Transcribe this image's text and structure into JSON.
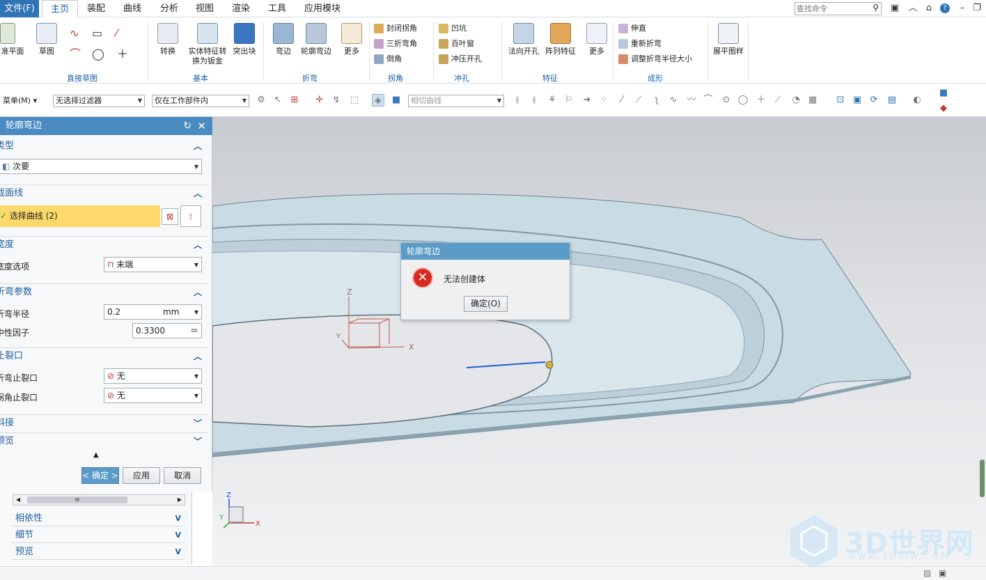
{
  "menubar": {
    "file": "文件(F)",
    "tabs": [
      "主页",
      "装配",
      "曲线",
      "分析",
      "视图",
      "渲染",
      "工具",
      "应用模块"
    ],
    "search_placeholder": "查找命令"
  },
  "ribbon": {
    "b_jizhun": "准平面",
    "b_caotu": "草图",
    "g_zhijiecaotu": "直接草图",
    "b_zhuanhuan": "转换",
    "b_shiti": "实体特征转换为钣金",
    "b_tuchukuai": "突出块",
    "g_jiben": "基本",
    "b_wanbian": "弯边",
    "b_lunkuo": "轮廓弯边",
    "b_gengduo1": "更多",
    "g_zhewan": "折弯",
    "s_fengbi": "封闭拐角",
    "s_sanzhe": "三折弯角",
    "s_daojiao": "倒角",
    "g_guaijiao": "拐角",
    "s_aokeng": "凹坑",
    "s_baiye": "百叶窗",
    "s_chongya": "冲压开孔",
    "g_chongkong": "冲孔",
    "b_faxiang": "法向开孔",
    "b_zhenlie": "阵列特征",
    "b_gengduo2": "更多",
    "g_tezheng": "特征",
    "s_shenzhi": "伸直",
    "s_chongxin": "重新折弯",
    "s_tiaozheng": "调整折弯半径大小",
    "g_chengxing": "成形",
    "b_zhanping": "展平图样"
  },
  "toolbar2": {
    "menu": "菜单(M)",
    "filter": "无选择过滤器",
    "scope": "仅在工作部件内",
    "curve_rule": "相切曲线"
  },
  "panel": {
    "title": "轮廓弯边",
    "sec_type": "类型",
    "type_value": "次要",
    "sec_section": "截面线",
    "select_curve": "选择曲线 (2)",
    "sec_width": "宽度",
    "width_option_label": "宽度选项",
    "width_option_value": "末端",
    "sec_bend": "折弯参数",
    "bend_radius_label": "折弯半径",
    "bend_radius_value": "0.2",
    "bend_radius_unit": "mm",
    "neutral_label": "中性因子",
    "neutral_value": "0.3300",
    "sec_relief": "止裂口",
    "bend_relief_label": "折弯止裂口",
    "bend_relief_value": "无",
    "corner_relief_label": "拐角止裂口",
    "corner_relief_value": "无",
    "sec_miter": "斜接",
    "sec_preview": "预览",
    "ok": "< 确定 >",
    "apply": "应用",
    "cancel": "取消"
  },
  "lower": {
    "scroll_label": "III",
    "dependency": "相依性",
    "detail": "细节",
    "preview": "预览"
  },
  "msgbox": {
    "title": "轮廓弯边",
    "message": "无法创建体",
    "ok": "确定(O)"
  },
  "axes": {
    "z": "Z",
    "y": "Y",
    "x": "X"
  },
  "watermark": {
    "main": "3D世界网",
    "sub": "WWW.3DSJW.COM"
  }
}
